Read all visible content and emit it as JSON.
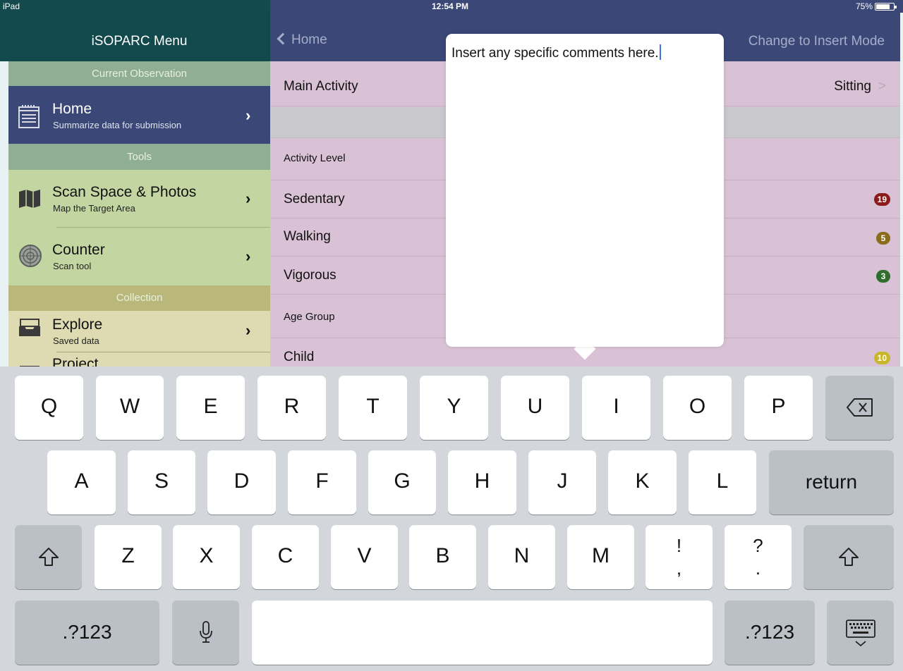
{
  "status_bar": {
    "carrier": "iPad",
    "time": "12:54 PM",
    "battery": "75%"
  },
  "menu": {
    "title": "iSOPARC Menu",
    "sections": {
      "current": "Current Observation",
      "tools": "Tools",
      "collection": "Collection"
    },
    "items": [
      {
        "label": "Home",
        "sub": "Summarize data for submission"
      },
      {
        "label": "Scan Space & Photos",
        "sub": "Map the Target Area"
      },
      {
        "label": "Counter",
        "sub": "Scan tool"
      },
      {
        "label": "Explore",
        "sub": "Saved data"
      },
      {
        "label": "Project",
        "sub": ""
      }
    ]
  },
  "navbar": {
    "back_label": "Home",
    "action_label": "Change to Insert Mode"
  },
  "content": {
    "main_activity": {
      "label": "Main Activity",
      "value": "Sitting"
    },
    "activity_level_header": "Activity Level",
    "activity_rows": [
      {
        "label": "Sedentary",
        "count": "19",
        "color": "#8b1a1a"
      },
      {
        "label": "Walking",
        "count": "5",
        "color": "#8a6d1a"
      },
      {
        "label": "Vigorous",
        "count": "3",
        "color": "#2f6e2f"
      }
    ],
    "age_group_header": "Age Group",
    "age_rows": [
      {
        "label": "Child",
        "count": "10",
        "color": "#c9b72a"
      }
    ]
  },
  "popover": {
    "text": "Insert any specific comments here."
  },
  "keyboard": {
    "row1": [
      "Q",
      "W",
      "E",
      "R",
      "T",
      "Y",
      "U",
      "I",
      "O",
      "P"
    ],
    "row2": [
      "A",
      "S",
      "D",
      "F",
      "G",
      "H",
      "J",
      "K",
      "L"
    ],
    "row3": [
      "Z",
      "X",
      "C",
      "V",
      "B",
      "N",
      "M"
    ],
    "punct1_top": "!",
    "punct1_bottom": ",",
    "punct2_top": "?",
    "punct2_bottom": ".",
    "return_label": "return",
    "numbers_label": ".?123",
    "icons": {
      "delete": "delete-icon",
      "shift": "shift-icon",
      "mic": "microphone-icon",
      "hide": "keyboard-hide-icon"
    }
  }
}
